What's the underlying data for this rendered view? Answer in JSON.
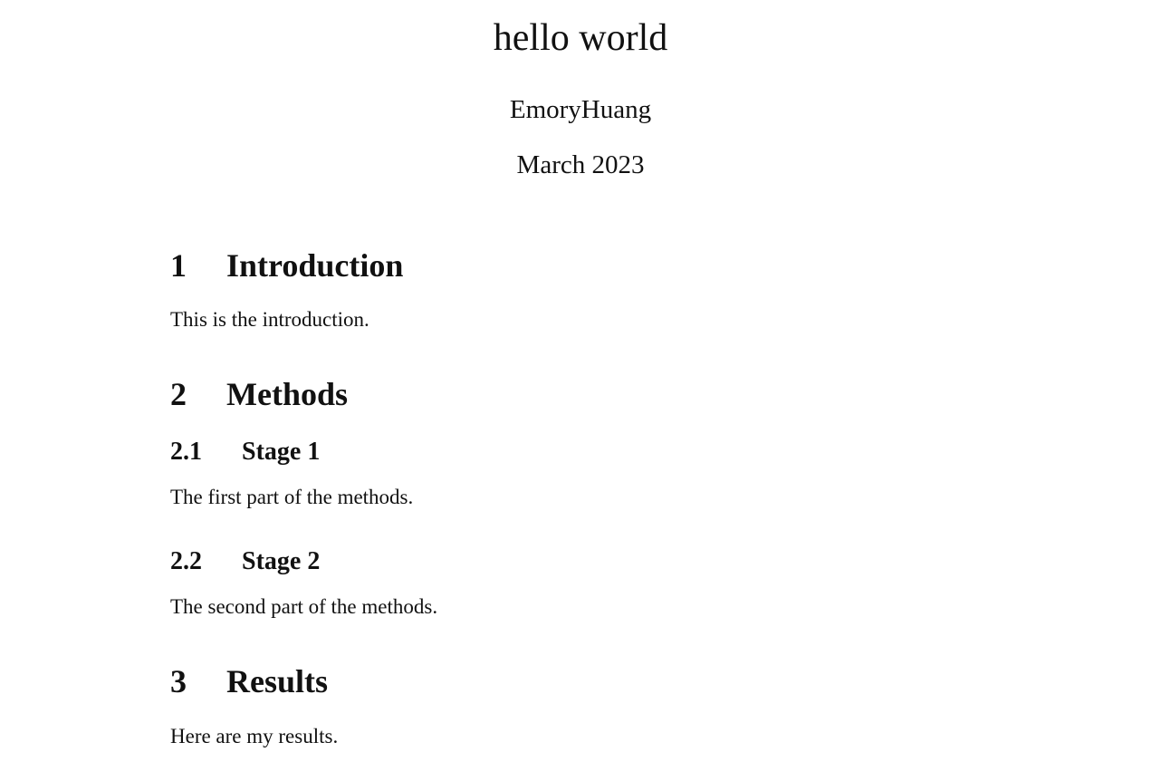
{
  "document": {
    "title": "hello world",
    "author": "EmoryHuang",
    "date": "March 2023"
  },
  "sections": [
    {
      "number": "1",
      "title": "Introduction",
      "text": "This is the introduction."
    },
    {
      "number": "2",
      "title": "Methods",
      "subsections": [
        {
          "number": "2.1",
          "title": "Stage 1",
          "text": "The first part of the methods."
        },
        {
          "number": "2.2",
          "title": "Stage 2",
          "text": "The second part of the methods."
        }
      ]
    },
    {
      "number": "3",
      "title": "Results",
      "text": "Here are my results."
    }
  ]
}
